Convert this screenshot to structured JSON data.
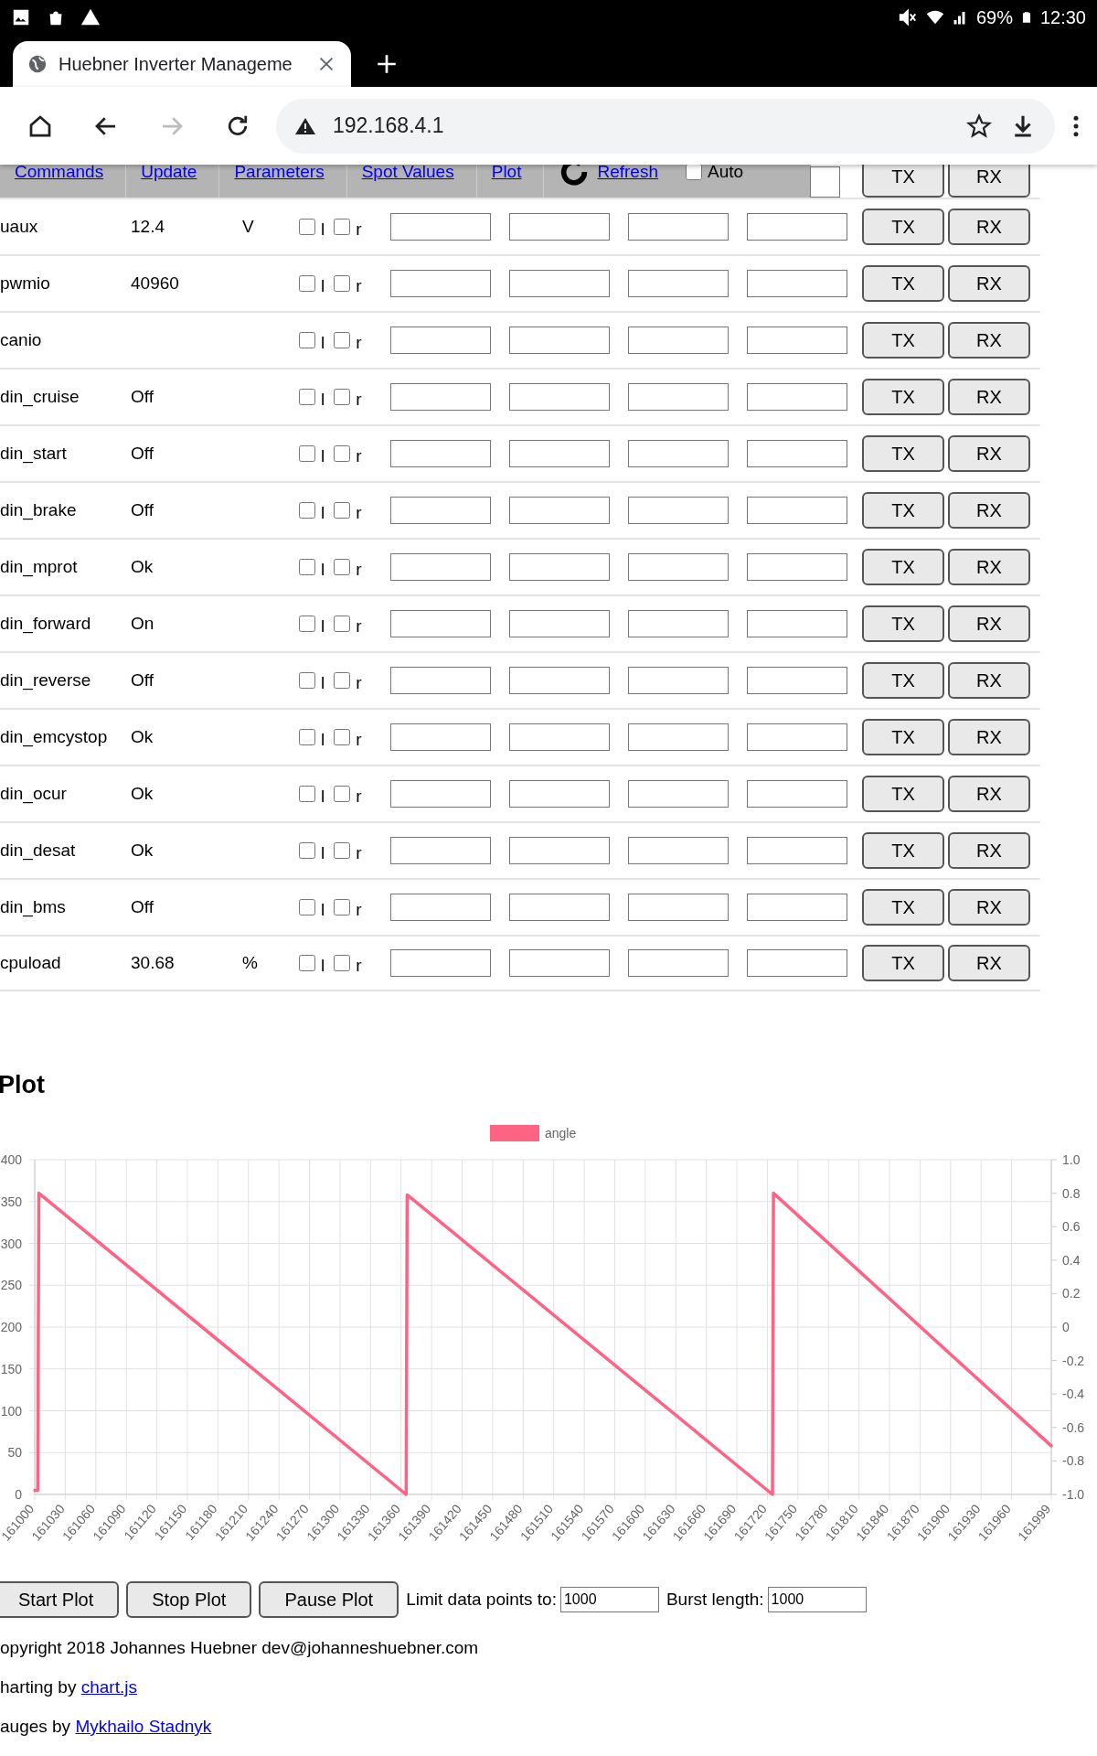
{
  "status_bar": {
    "battery": "69%",
    "time": "12:30"
  },
  "browser": {
    "tab_title": "Huebner Inverter Manageme",
    "url": "192.168.4.1",
    "forward_disabled": true
  },
  "nav": {
    "items": [
      "Commands",
      "Update",
      "Parameters",
      "Spot Values",
      "Plot"
    ],
    "refresh": "Refresh",
    "auto": {
      "label": "Auto",
      "checked": false
    },
    "buttons": [
      "TX",
      "RX"
    ]
  },
  "rows": [
    {
      "name": "uaux",
      "value": "12.4",
      "unit": "V",
      "checkboxes": [
        {
          "label": "l",
          "checked": false
        },
        {
          "label": "r",
          "checked": false
        }
      ],
      "buttons": [
        "TX",
        "RX"
      ]
    },
    {
      "name": "pwmio",
      "value": "40960",
      "checkboxes": [
        {
          "label": "l",
          "checked": false
        },
        {
          "label": "r",
          "checked": false
        }
      ],
      "buttons": [
        "TX",
        "RX"
      ]
    },
    {
      "name": "canio",
      "checkboxes": [
        {
          "label": "l",
          "checked": false
        },
        {
          "label": "r",
          "checked": false
        }
      ],
      "buttons": [
        "TX",
        "RX"
      ]
    },
    {
      "name": "din_cruise",
      "value": "Off",
      "checkboxes": [
        {
          "label": "l",
          "checked": false
        },
        {
          "label": "r",
          "checked": false
        }
      ],
      "buttons": [
        "TX",
        "RX"
      ]
    },
    {
      "name": "din_start",
      "value": "Off",
      "checkboxes": [
        {
          "label": "l",
          "checked": false
        },
        {
          "label": "r",
          "checked": false
        }
      ],
      "buttons": [
        "TX",
        "RX"
      ]
    },
    {
      "name": "din_brake",
      "value": "Off",
      "checkboxes": [
        {
          "label": "l",
          "checked": false
        },
        {
          "label": "r",
          "checked": false
        }
      ],
      "buttons": [
        "TX",
        "RX"
      ]
    },
    {
      "name": "din_mprot",
      "value": "Ok",
      "checkboxes": [
        {
          "label": "l",
          "checked": false
        },
        {
          "label": "r",
          "checked": false
        }
      ],
      "buttons": [
        "TX",
        "RX"
      ]
    },
    {
      "name": "din_forward",
      "value": "On",
      "checkboxes": [
        {
          "label": "l",
          "checked": false
        },
        {
          "label": "r",
          "checked": false
        }
      ],
      "buttons": [
        "TX",
        "RX"
      ]
    },
    {
      "name": "din_reverse",
      "value": "Off",
      "checkboxes": [
        {
          "label": "l",
          "checked": false
        },
        {
          "label": "r",
          "checked": false
        }
      ],
      "buttons": [
        "TX",
        "RX"
      ]
    },
    {
      "name": "din_emcystop",
      "value": "Ok",
      "checkboxes": [
        {
          "label": "l",
          "checked": false
        },
        {
          "label": "r",
          "checked": false
        }
      ],
      "buttons": [
        "TX",
        "RX"
      ]
    },
    {
      "name": "din_ocur",
      "value": "Ok",
      "checkboxes": [
        {
          "label": "l",
          "checked": false
        },
        {
          "label": "r",
          "checked": false
        }
      ],
      "buttons": [
        "TX",
        "RX"
      ]
    },
    {
      "name": "din_desat",
      "value": "Ok",
      "checkboxes": [
        {
          "label": "l",
          "checked": false
        },
        {
          "label": "r",
          "checked": false
        }
      ],
      "buttons": [
        "TX",
        "RX"
      ]
    },
    {
      "name": "din_bms",
      "value": "Off",
      "checkboxes": [
        {
          "label": "l",
          "checked": false
        },
        {
          "label": "r",
          "checked": false
        }
      ],
      "buttons": [
        "TX",
        "RX"
      ]
    },
    {
      "name": "cpuload",
      "value": "30.68",
      "unit": "%",
      "checkboxes": [
        {
          "label": "l",
          "checked": false
        },
        {
          "label": "r",
          "checked": false
        }
      ],
      "buttons": [
        "TX",
        "RX"
      ]
    }
  ],
  "plot": {
    "title": "Plot",
    "right_axis_ticks": [
      "1.0",
      "0.8",
      "0.6",
      "0.4",
      "0.2",
      "0",
      "-0.2",
      "-0.4",
      "-0.6",
      "-0.8",
      "-1.0"
    ],
    "chart_data": {
      "type": "line",
      "grid": true,
      "xlim": [
        161000,
        161999
      ],
      "ylim": [
        0,
        400
      ],
      "yticks": [
        0,
        50,
        100,
        150,
        200,
        250,
        300,
        350,
        400
      ],
      "xticks": [
        161000,
        161030,
        161060,
        161090,
        161120,
        161150,
        161180,
        161210,
        161240,
        161270,
        161300,
        161330,
        161360,
        161390,
        161420,
        161450,
        161480,
        161510,
        161540,
        161570,
        161600,
        161630,
        161660,
        161690,
        161720,
        161750,
        161780,
        161810,
        161840,
        161870,
        161900,
        161930,
        161960,
        161999
      ],
      "x": [
        161000,
        161003,
        161004,
        161365,
        161366,
        161725,
        161726,
        161999
      ],
      "series": [
        {
          "name": "angle",
          "color": "#ff6384",
          "values": [
            5,
            5,
            360,
            0,
            358,
            0,
            360,
            58
          ]
        }
      ]
    }
  },
  "controls": {
    "buttons": [
      "Start Plot",
      "Stop Plot",
      "Pause Plot"
    ],
    "fields": [
      {
        "label": "Limit data points to:",
        "value": "1000"
      },
      {
        "label": "Burst length:",
        "value": "1000"
      }
    ]
  },
  "footer": [
    {
      "text": "opyright 2018 Johannes Huebner dev@johanneshuebner.com"
    },
    {
      "text": "harting by ",
      "link": "chart.js"
    },
    {
      "text": "auges by ",
      "link": "Mykhailo Stadnyk"
    }
  ]
}
